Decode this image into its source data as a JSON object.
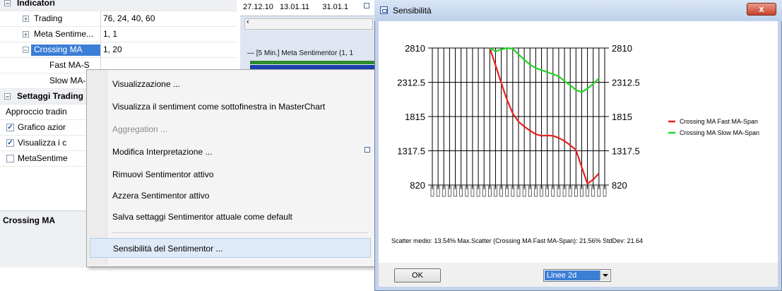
{
  "left_panel": {
    "rows": [
      {
        "name": "Indicatori",
        "value": ""
      },
      {
        "name": "Trading",
        "value": "76, 24, 40, 60"
      },
      {
        "name": "Meta Sentime...",
        "value": "1, 1"
      },
      {
        "name": "Crossing MA",
        "value": "1, 20"
      },
      {
        "name": "Fast MA-S",
        "value": ""
      },
      {
        "name": "Slow MA-",
        "value": ""
      },
      {
        "name": "Settaggi Trading",
        "value": ""
      },
      {
        "name": "Approccio tradin",
        "value": ""
      },
      {
        "name": "Grafico azior",
        "value": ""
      },
      {
        "name": "Visualizza i c",
        "value": ""
      },
      {
        "name": "MetaSentime",
        "value": ""
      }
    ],
    "bottom_label": "Crossing MA"
  },
  "background_chart": {
    "dates": "27.12.10   13.01.11      31.01.1",
    "legend": "— [5 Min.] Meta Sentimentor  (1, 1"
  },
  "context_menu": {
    "items": [
      {
        "label": "Visualizzazione ...",
        "disabled": false
      },
      {
        "label": "Visualizza il sentiment come sottofinestra in MasterChart",
        "disabled": false
      },
      {
        "label": "Aggregation ...",
        "disabled": true
      },
      {
        "label": "Modifica Interpretazione ...",
        "disabled": false
      },
      {
        "label": "Rimuovi Sentimentor attivo",
        "disabled": false
      },
      {
        "label": "Azzera Sentimentor attivo",
        "disabled": false
      },
      {
        "label": "Salva settaggi Sentimentor attuale come default",
        "disabled": false
      },
      {
        "label": "Sensibilità del Sentimentor ...",
        "disabled": false
      }
    ]
  },
  "dialog": {
    "title": "Sensibilità",
    "close_label": "x",
    "ok_label": "OK",
    "select_value": "Linee 2d",
    "stats": "Scatter medio: 13.54%  Max.Scatter (Crossing MA Fast MA-Span): 21.56%  StdDev: 21.64"
  },
  "chart_data": {
    "type": "line",
    "x": [
      1,
      2,
      3,
      4,
      5,
      6,
      7,
      8,
      9,
      10,
      11,
      12,
      13,
      14,
      15,
      16,
      17,
      18,
      19,
      20,
      21,
      22,
      23,
      24,
      25,
      26,
      27,
      28,
      29,
      30,
      31
    ],
    "yticks": [
      2810,
      2312.5,
      1815,
      1317.5,
      820
    ],
    "ylim": [
      820,
      2810
    ],
    "grid": true,
    "legend_position": "right",
    "series": [
      {
        "name": "Crossing MA Fast MA-Span",
        "color": "#e8201c",
        "values": [
          null,
          null,
          null,
          null,
          null,
          null,
          null,
          null,
          null,
          null,
          2810,
          2560,
          2300,
          2060,
          1860,
          1740,
          1670,
          1610,
          1560,
          1535,
          1540,
          1535,
          1505,
          1460,
          1400,
          1330,
          1080,
          840,
          900,
          990,
          null
        ]
      },
      {
        "name": "Crossing MA Slow MA-Span",
        "color": "#22d422",
        "values": [
          null,
          null,
          null,
          null,
          null,
          null,
          null,
          null,
          null,
          null,
          2810,
          2760,
          2790,
          2810,
          2800,
          2720,
          2640,
          2570,
          2520,
          2490,
          2460,
          2430,
          2400,
          2330,
          2270,
          2200,
          2170,
          2220,
          2290,
          2370,
          null
        ]
      }
    ]
  },
  "colors": {
    "selection": "#3b7ed6",
    "title_gradient_top": "#d9e6f6",
    "close": "#c8412a"
  }
}
